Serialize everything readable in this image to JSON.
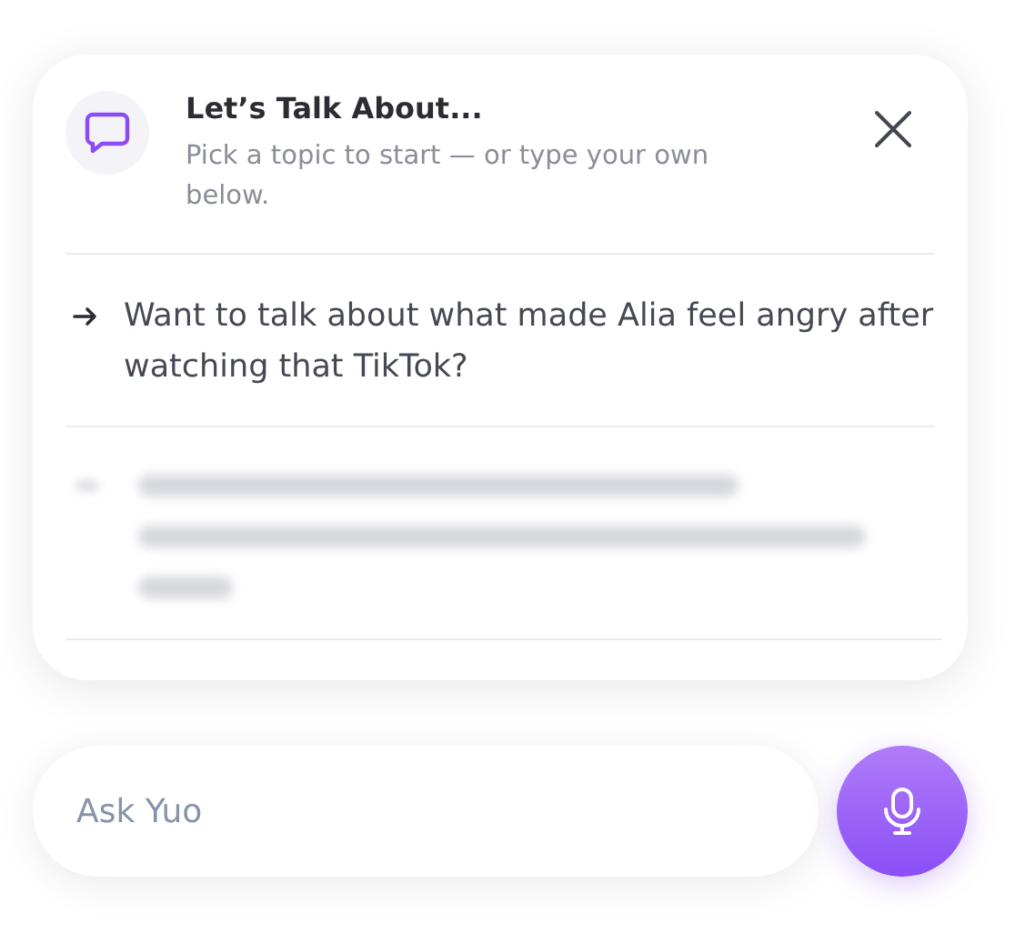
{
  "panel": {
    "title": "Let’s Talk About...",
    "subtitle": "Pick a topic to start — or type your own below."
  },
  "topics": [
    {
      "text": "Want to talk about what made Alia feel angry after watching that TikTok?",
      "blurred": false
    },
    {
      "blurred": true
    }
  ],
  "input": {
    "placeholder": "Ask Yuo"
  }
}
